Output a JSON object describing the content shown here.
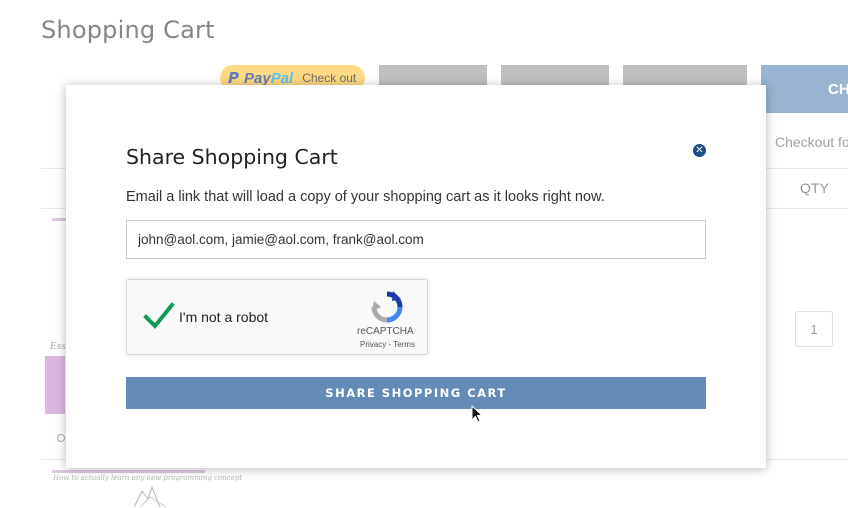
{
  "page": {
    "title": "Shopping Cart",
    "paypal": {
      "brand_pay": "Pay",
      "brand_pal": "Pal",
      "label": "Check out"
    },
    "checkout_button": "CH",
    "checkout_note": "Checkout fo",
    "qty_header": "QTY",
    "qty_value": "1",
    "thumb_caption": "How to actually learn any new programming concept",
    "thumb2_caption": "Ess"
  },
  "modal": {
    "title": "Share Shopping Cart",
    "close_icon": "close-icon",
    "description": "Email a link that will load a copy of your shopping cart as it looks right now.",
    "email_value": "john@aol.com, jamie@aol.com, frank@aol.com",
    "recaptcha": {
      "label": "I'm not a robot",
      "brand": "reCAPTCHA",
      "links": "Privacy - Terms",
      "checked": true
    },
    "share_button": "SHARE SHOPPING CART"
  },
  "colors": {
    "accent": "#638bb5",
    "close": "#1d4e89",
    "check": "#0f9d58",
    "paypal": "#ffc439"
  }
}
